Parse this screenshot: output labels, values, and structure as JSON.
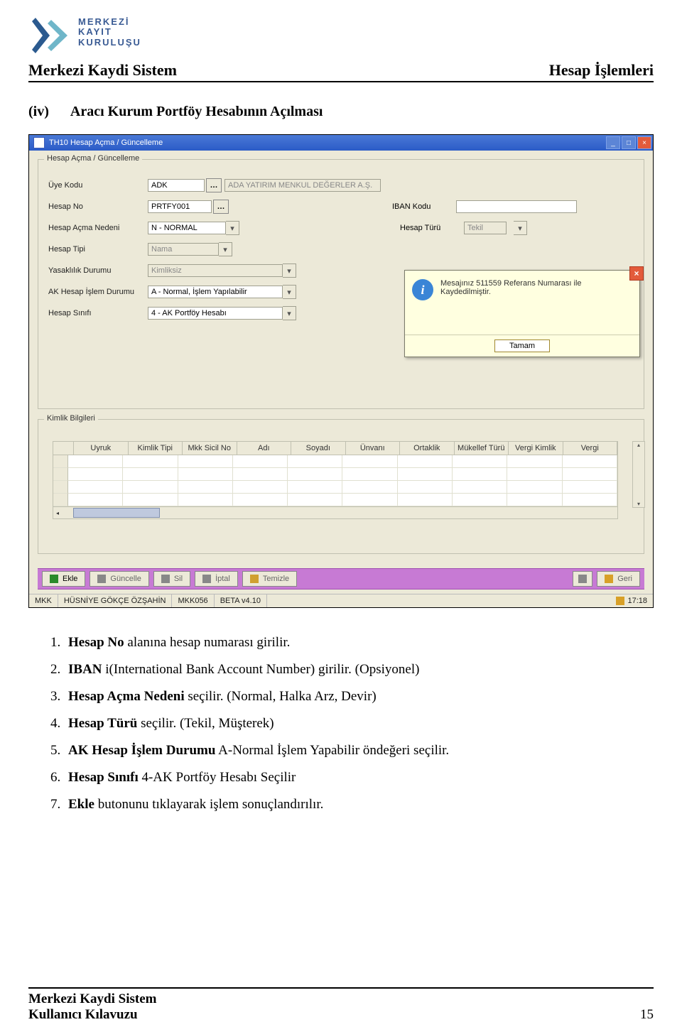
{
  "header": {
    "brand_line1": "MERKEZİ",
    "brand_line2": "KAYIT",
    "brand_line3": "KURULUŞU",
    "left_title": "Merkezi Kaydi Sistem",
    "right_title": "Hesap İşlemleri"
  },
  "section": {
    "num": "(iv)",
    "title": "Aracı Kurum Portföy Hesabının Açılması"
  },
  "window": {
    "title": "TH10 Hesap Açma / Güncelleme",
    "fieldset_title": "Hesap Açma / Güncelleme",
    "labels": {
      "uye_kodu": "Üye Kodu",
      "hesap_no": "Hesap No",
      "hesap_acma_nedeni": "Hesap Açma Nedeni",
      "hesap_tipi": "Hesap Tipi",
      "yasaklilik": "Yasaklılık Durumu",
      "ak_islem": "AK Hesap İşlem Durumu",
      "hesap_sinifi": "Hesap Sınıfı",
      "iban_kodu": "IBAN Kodu",
      "hesap_turu": "Hesap Türü"
    },
    "values": {
      "uye_kodu": "ADK",
      "uye_adi": "ADA YATIRIM MENKUL DEĞERLER A.Ş.",
      "hesap_no": "PRTFY001",
      "hesap_acma_nedeni": "N - NORMAL",
      "hesap_tipi": "Nama",
      "yasaklilik": "Kimliksiz",
      "ak_islem": "A - Normal, İşlem Yapılabilir",
      "hesap_sinifi": "4 - AK Portföy Hesabı",
      "iban_kodu": "",
      "hesap_turu": "Tekil"
    },
    "fieldset2_title": "Kimlik Bilgileri",
    "grid_headers": [
      "Uyruk",
      "Kimlik Tipi",
      "Mkk Sicil No",
      "Adı",
      "Soyadı",
      "Ünvanı",
      "Ortaklik",
      "Mükellef Türü",
      "Vergi Kimlik",
      "Vergi"
    ],
    "action_buttons": {
      "ekle": "Ekle",
      "guncelle": "Güncelle",
      "sil": "Sil",
      "iptal": "İptal",
      "temizle": "Temizle",
      "geri": "Geri"
    },
    "statusbar": {
      "c1": "MKK",
      "c2": "HÜSNİYE GÖKÇE ÖZŞAHİN",
      "c3": "MKK056",
      "c4": "BETA v4.10",
      "time": "17:18"
    },
    "popup": {
      "message": "Mesajınız 511559 Referans Numarası ile Kaydedilmiştir.",
      "ok": "Tamam"
    }
  },
  "steps": [
    {
      "pre": "",
      "bold": "Hesap No",
      "post": " alanına hesap numarası girilir."
    },
    {
      "pre": "",
      "bold": "IBAN",
      "post": " i(International Bank Account Number) girilir. (Opsiyonel)"
    },
    {
      "pre": "",
      "bold": "Hesap Açma Nedeni",
      "post": " seçilir. (Normal, Halka Arz, Devir)"
    },
    {
      "pre": "",
      "bold": "Hesap Türü",
      "post": " seçilir. (Tekil, Müşterek)"
    },
    {
      "pre": "",
      "bold": "AK Hesap İşlem Durumu",
      "post": " A-Normal İşlem Yapabilir öndeğeri seçilir."
    },
    {
      "pre": "",
      "bold": "Hesap Sınıfı",
      "post": " 4-AK Portföy  Hesabı Seçilir"
    },
    {
      "pre": "",
      "bold": "Ekle",
      "post": " butonunu tıklayarak işlem sonuçlandırılır."
    }
  ],
  "footer": {
    "line1": "Merkezi Kaydi Sistem",
    "line2": "Kullanıcı Kılavuzu",
    "page": "15"
  }
}
